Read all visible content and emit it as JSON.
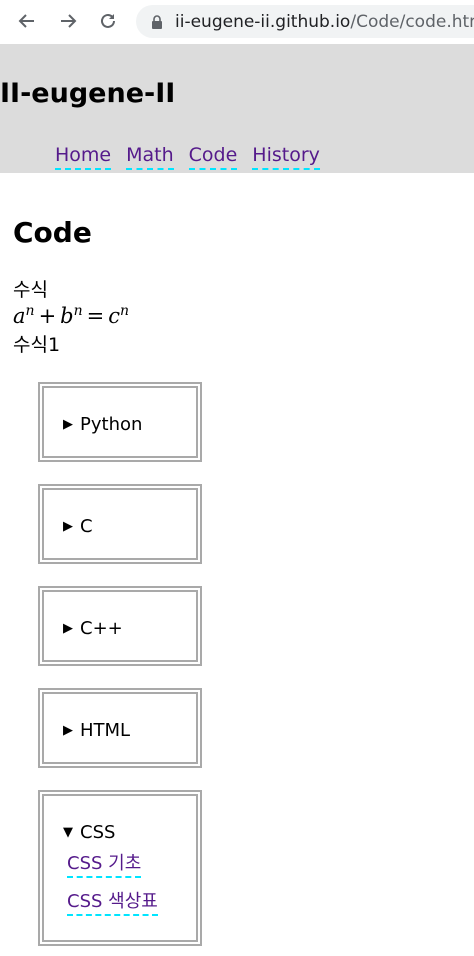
{
  "browser": {
    "url_host": "ii-eugene-ii.github.io",
    "url_path": "/Code/code.html"
  },
  "site": {
    "title": "II-eugene-II",
    "nav": [
      "Home",
      "Math",
      "Code",
      "History"
    ]
  },
  "main": {
    "page_title": "Code",
    "label1": "수식",
    "label2": "수식1",
    "details": [
      {
        "summary": "Python",
        "open": false
      },
      {
        "summary": "C",
        "open": false
      },
      {
        "summary": "C++",
        "open": false
      },
      {
        "summary": "HTML",
        "open": false
      },
      {
        "summary": "CSS",
        "open": true,
        "links": [
          "CSS 기초",
          "CSS 색상표"
        ]
      }
    ]
  },
  "icons": {
    "closed": "▶",
    "open": "▼"
  }
}
